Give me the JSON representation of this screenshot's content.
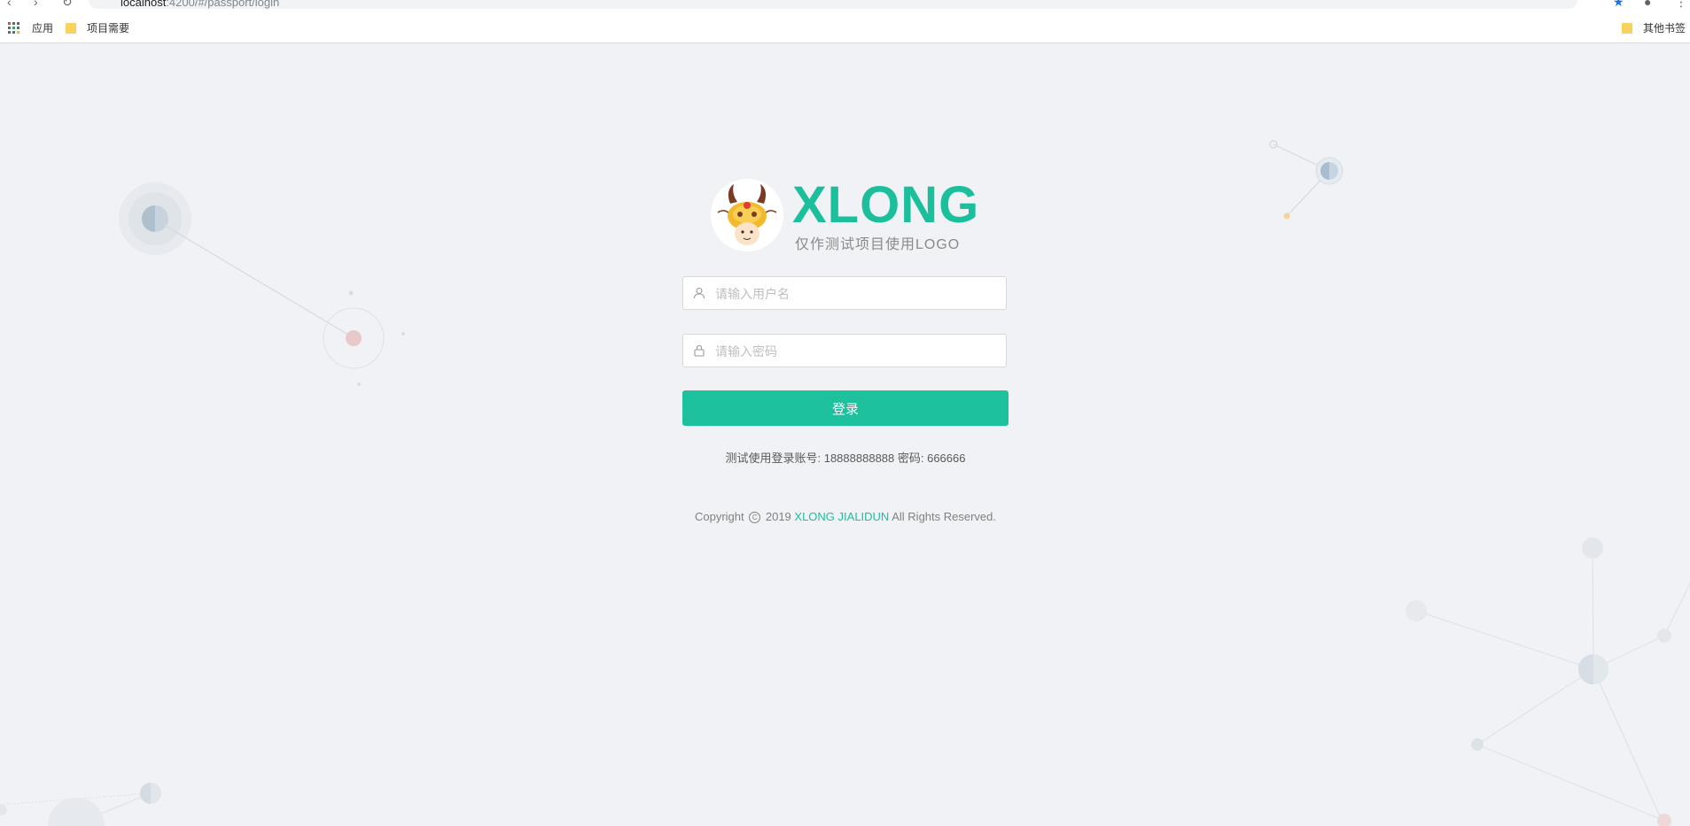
{
  "browser": {
    "url_host": "localhost",
    "url_path": ":4200/#/passport/login",
    "bookmarks": {
      "apps_label": "应用",
      "folder_1": "项目需要",
      "other": "其他书签"
    }
  },
  "logo": {
    "title": "XLONG",
    "subtitle": "仅作测试项目使用LOGO"
  },
  "form": {
    "username_placeholder": "请输入用户名",
    "password_placeholder": "请输入密码",
    "login_label": "登录"
  },
  "hint": "测试使用登录账号: 18888888888 密码: 666666",
  "footer": {
    "prefix": "Copyright",
    "year": "2019",
    "brand": "XLONG JIALIDUN",
    "suffix": "All Rights Reserved.",
    "copyright_symbol": "C"
  },
  "colors": {
    "accent": "#1dc19e",
    "background": "#f0f2f5"
  }
}
